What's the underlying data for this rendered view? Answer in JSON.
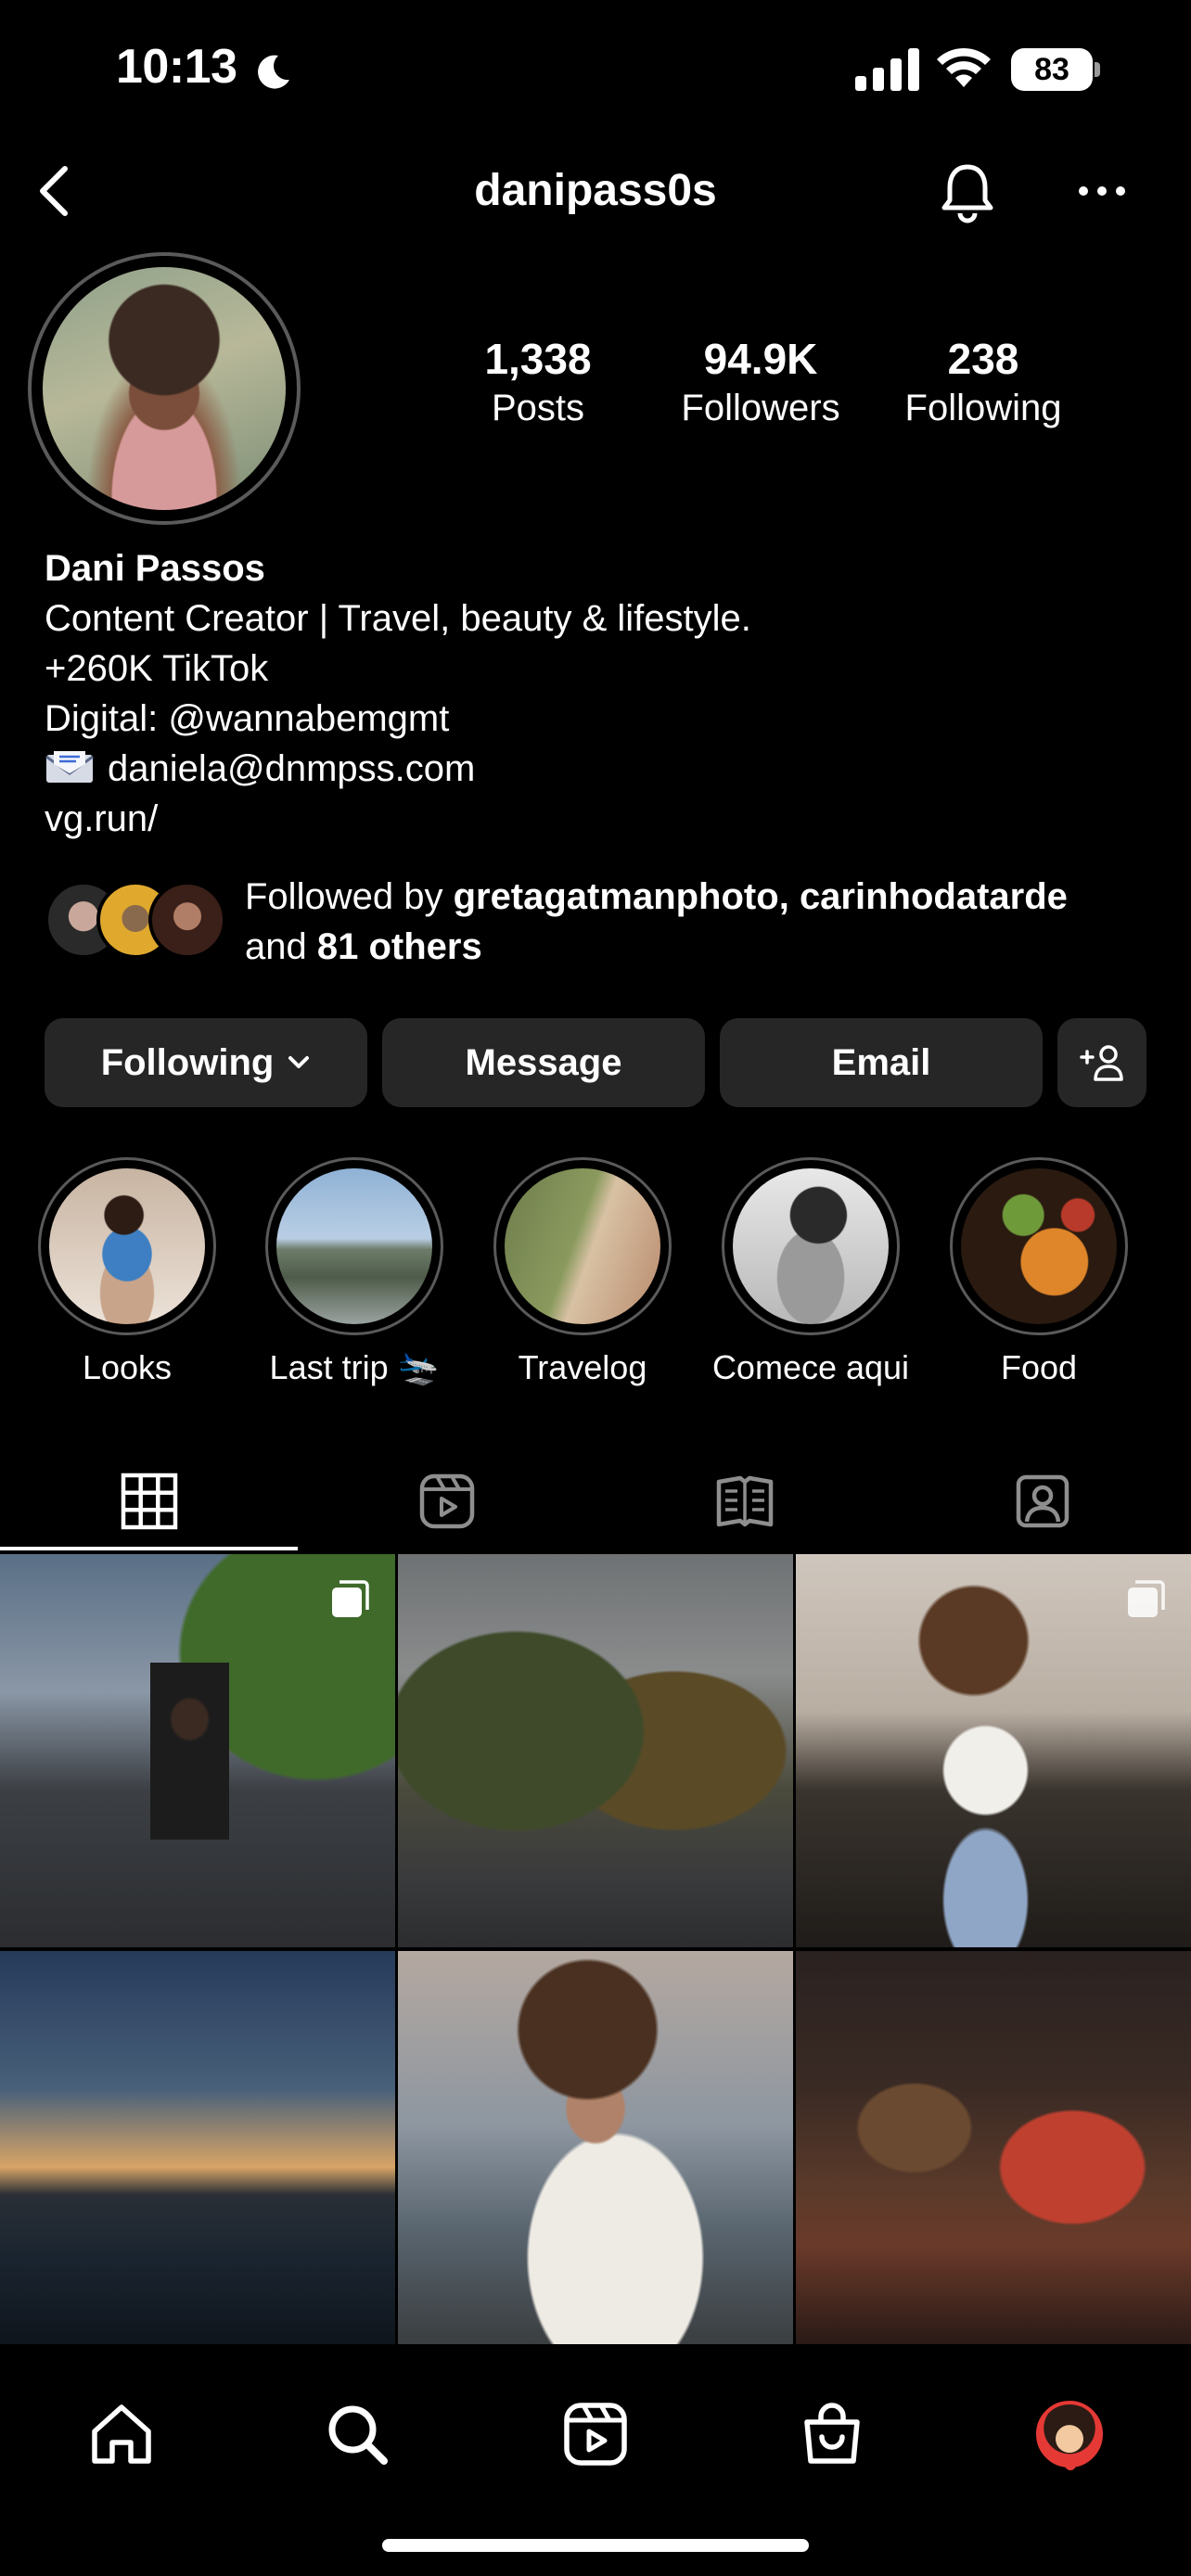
{
  "status_bar": {
    "time": "10:13",
    "battery": "83"
  },
  "header": {
    "username": "danipass0s"
  },
  "stats": {
    "posts_value": "1,338",
    "posts_label": "Posts",
    "followers_value": "94.9K",
    "followers_label": "Followers",
    "following_value": "238",
    "following_label": "Following"
  },
  "bio": {
    "name": "Dani Passos",
    "line1": "Content Creator | Travel, beauty & lifestyle.",
    "line2": "+260K TikTok",
    "line3": "Digital: @wannabemgmt",
    "email": "daniela@dnmpss.com",
    "link": "vg.run/"
  },
  "followed_by": {
    "prefix": "Followed by",
    "user1": "gretagatmanphoto",
    "separator": ",",
    "user2": "carinhodatarde",
    "and": "and",
    "others": "81 others"
  },
  "buttons": {
    "following": "Following",
    "message": "Message",
    "email": "Email"
  },
  "highlights": [
    {
      "label": "Looks"
    },
    {
      "label": "Last trip 🛬"
    },
    {
      "label": "Travelog"
    },
    {
      "label": "Comece aqui"
    },
    {
      "label": "Food"
    }
  ],
  "tabs": [
    {
      "icon": "grid-icon"
    },
    {
      "icon": "reels-icon"
    },
    {
      "icon": "guides-icon"
    },
    {
      "icon": "tagged-icon"
    }
  ],
  "bottom_nav": [
    {
      "icon": "home-icon"
    },
    {
      "icon": "search-icon"
    },
    {
      "icon": "reels-icon"
    },
    {
      "icon": "shop-icon"
    },
    {
      "icon": "profile-avatar"
    }
  ],
  "colors": {
    "background": "#000000",
    "button": "#262626",
    "ring": "#5a5a5a",
    "notification": "#e53935"
  }
}
